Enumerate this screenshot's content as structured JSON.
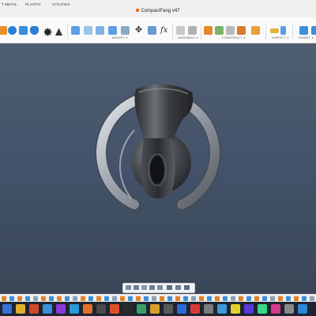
{
  "app": {
    "tabs": [
      "T METAL",
      "PLASTIC",
      "UTILITIES"
    ],
    "document_title": "CompactFang v47"
  },
  "ribbon": {
    "groups": [
      {
        "label": "MODIFY"
      },
      {
        "label": "ASSEMBLE"
      },
      {
        "label": "CONSTRUCT"
      },
      {
        "label": "INSPECT"
      },
      {
        "label": "INSERT"
      }
    ]
  },
  "colors": {
    "accent": "#f06a1a",
    "ribbon_blue": "#2a7fd4",
    "viewport_bg": "#4a5769"
  },
  "icons": [
    "extrude-icon",
    "revolve-icon",
    "sphere-icon",
    "cylinder-icon",
    "gear-icon",
    "cone-icon",
    "shell-icon",
    "press-pull-icon",
    "fillet-icon",
    "move-icon",
    "align-icon",
    "formula-icon",
    "joint-icon",
    "as-built-joint-icon",
    "offset-plane-icon",
    "axis-icon",
    "point-icon",
    "measure-icon",
    "insert-image-icon"
  ]
}
